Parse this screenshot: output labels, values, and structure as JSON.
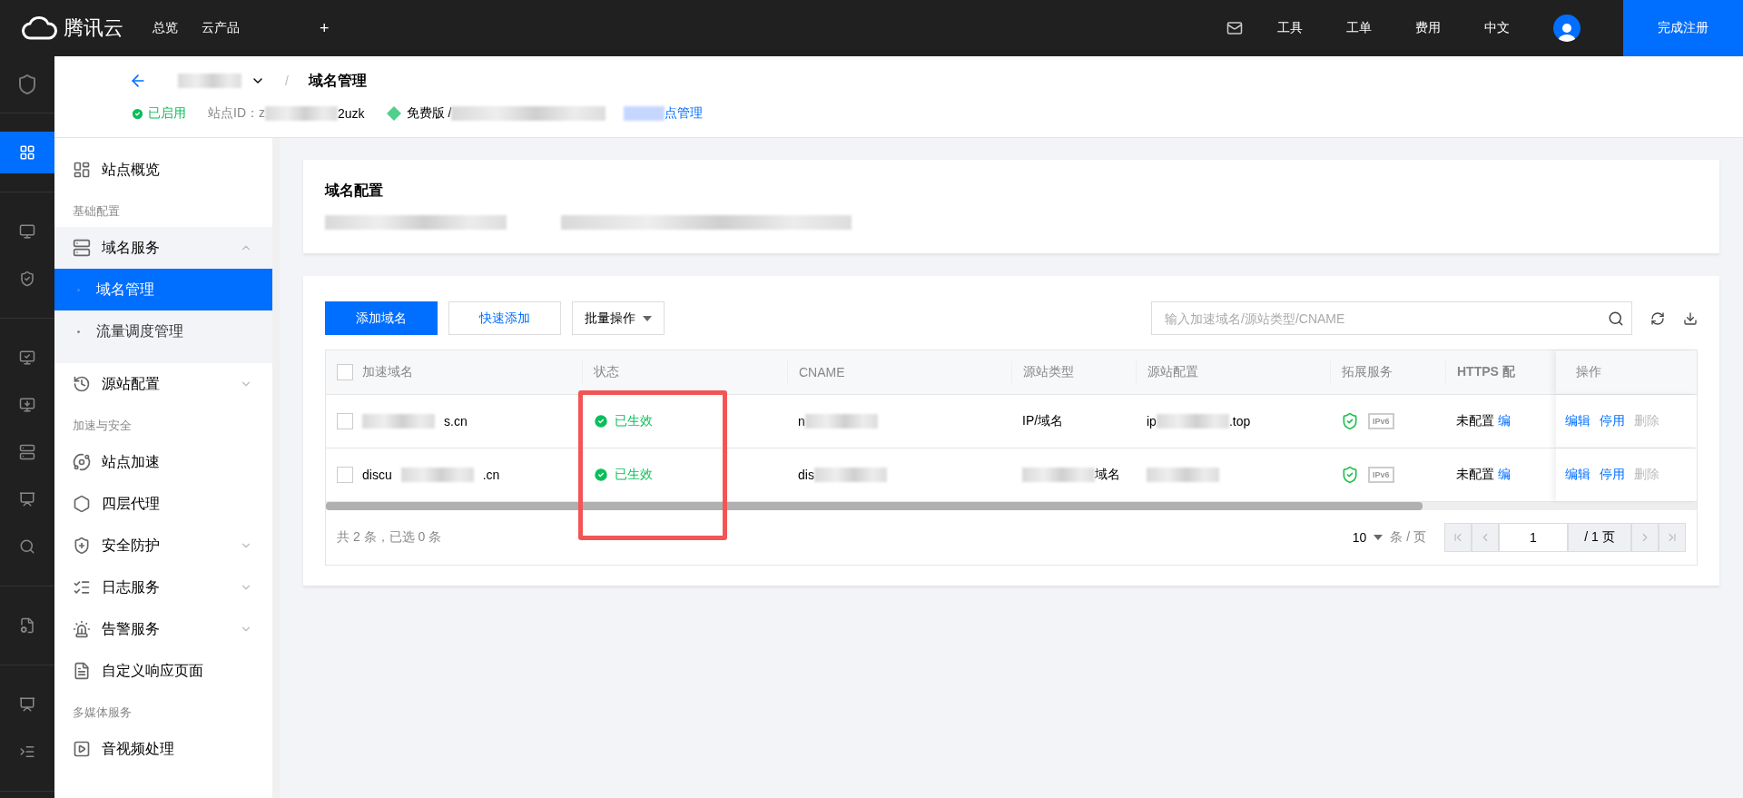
{
  "topbar": {
    "brand": "腾讯云",
    "nav": [
      "总览",
      "云产品"
    ],
    "add": "+",
    "links": [
      "工具",
      "工单",
      "费用",
      "中文"
    ],
    "register": "完成注册"
  },
  "rail": {
    "groups": [
      [
        {
          "selected": true
        }
      ],
      [
        {
          "selected": false
        },
        {
          "selected": false
        }
      ],
      [
        {
          "selected": false
        },
        {
          "selected": false
        },
        {
          "selected": false
        },
        {
          "selected": false
        },
        {
          "selected": false
        }
      ],
      [
        {
          "selected": false
        }
      ],
      [
        {
          "selected": false
        },
        {
          "selected": false
        }
      ]
    ]
  },
  "header": {
    "title": "域名管理",
    "separator": "/",
    "status": "已启用",
    "site_id_label": "站点ID：z",
    "site_id_tail": "2uzk",
    "plan": "免费版 /",
    "manage_link": "点管理"
  },
  "sidebar": {
    "items": [
      {
        "kind": "item",
        "label": "站点概览"
      },
      {
        "kind": "group",
        "label": "基础配置"
      },
      {
        "kind": "item",
        "label": "域名服务",
        "expanded": true,
        "children": [
          {
            "label": "域名管理",
            "selected": true
          },
          {
            "label": "流量调度管理",
            "selected": false
          }
        ]
      },
      {
        "kind": "item",
        "label": "源站配置",
        "expanded": false
      },
      {
        "kind": "group",
        "label": "加速与安全"
      },
      {
        "kind": "item",
        "label": "站点加速"
      },
      {
        "kind": "item",
        "label": "四层代理"
      },
      {
        "kind": "item",
        "label": "安全防护",
        "expanded": false
      },
      {
        "kind": "item",
        "label": "日志服务",
        "expanded": false
      },
      {
        "kind": "item",
        "label": "告警服务",
        "expanded": false
      },
      {
        "kind": "item",
        "label": "自定义响应页面"
      },
      {
        "kind": "group",
        "label": "多媒体服务"
      },
      {
        "kind": "item",
        "label": "音视频处理"
      }
    ]
  },
  "config_card": {
    "title": "域名配置"
  },
  "toolbar": {
    "buttons": [
      {
        "kind": "primary",
        "label": "添加域名"
      },
      {
        "kind": "outline",
        "label": "快速添加"
      },
      {
        "kind": "dropdown",
        "label": "批量操作"
      }
    ],
    "search": {
      "placeholder": "输入加速域名/源站类型/CNAME"
    }
  },
  "table": {
    "all_checked": false,
    "columns": [
      "加速域名",
      "状态",
      "CNAME",
      "源站类型",
      "源站配置",
      "拓展服务",
      "HTTPS 配",
      "操作"
    ],
    "rows": [
      {
        "checked": false,
        "domain": [
          {
            "kind": "blur"
          },
          {
            "kind": "text",
            "text": "s.cn"
          }
        ],
        "status": "已生效",
        "cname": [
          {
            "kind": "text",
            "text": "n"
          },
          {
            "kind": "blur"
          }
        ],
        "origin_type": [
          {
            "kind": "text",
            "text": "IP/域名"
          }
        ],
        "origin": [
          {
            "kind": "text",
            "text": "ip"
          },
          {
            "kind": "blur"
          },
          {
            "kind": "text",
            "text": ".top"
          }
        ],
        "ipv6": "IPv6",
        "https": "未配置",
        "https_link": "编",
        "actions": [
          {
            "label": "编辑",
            "disabled": false
          },
          {
            "label": "停用",
            "disabled": false
          },
          {
            "label": "删除",
            "disabled": true
          }
        ]
      },
      {
        "checked": false,
        "domain": [
          {
            "kind": "text",
            "text": "discu"
          },
          {
            "kind": "blur"
          },
          {
            "kind": "text",
            "text": ".cn"
          }
        ],
        "status": "已生效",
        "cname": [
          {
            "kind": "text",
            "text": "dis"
          },
          {
            "kind": "blur"
          }
        ],
        "origin_type": [
          {
            "kind": "blur"
          },
          {
            "kind": "text",
            "text": "域名"
          }
        ],
        "origin": [
          {
            "kind": "blur"
          }
        ],
        "ipv6": "IPv6",
        "https": "未配置",
        "https_link": "编",
        "actions": [
          {
            "label": "编辑",
            "disabled": false
          },
          {
            "label": "停用",
            "disabled": false
          },
          {
            "label": "删除",
            "disabled": true
          }
        ]
      }
    ]
  },
  "footer": {
    "summary": "共 2 条，已选 0 条",
    "page_size": "10",
    "per_page": "条 / 页",
    "page": "1",
    "total": "/ 1 页"
  }
}
